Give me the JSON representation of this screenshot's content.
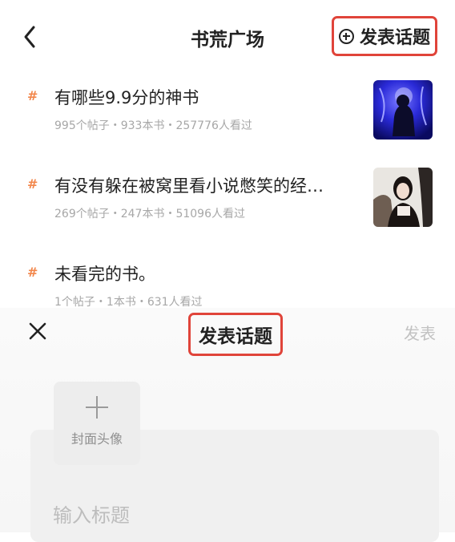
{
  "plaza": {
    "title": "书荒广场",
    "new_topic_label": "发表话题",
    "topics": [
      {
        "hash": "#",
        "title": "有哪些9.9分的神书",
        "meta": "995个帖子・933本书・257776人看过"
      },
      {
        "hash": "#",
        "title": "有没有躲在被窝里看小说憋笑的经…",
        "meta": "269个帖子・247本书・51096人看过"
      },
      {
        "hash": "#",
        "title": "未看完的书。",
        "meta": "1个帖子・1本书・631人看过"
      }
    ]
  },
  "compose": {
    "title": "发表话题",
    "publish_label": "发表",
    "cover_label": "封面头像",
    "title_placeholder": "输入标题"
  },
  "colors": {
    "highlight_border": "#e0443a",
    "hash": "#f2874c",
    "meta_text": "#a7a7a7",
    "publish_disabled": "#c2c2c2"
  },
  "icons": [
    "back-arrow-icon",
    "plus-circle-icon",
    "close-icon",
    "plus-icon"
  ]
}
